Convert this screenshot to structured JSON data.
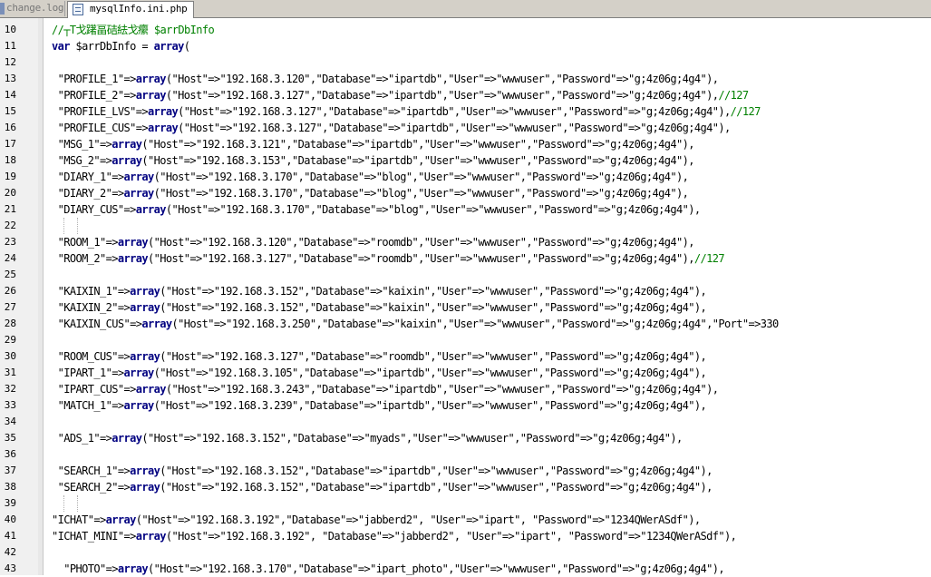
{
  "tabs": [
    {
      "label": "change.log",
      "active": false
    },
    {
      "label": "mysqlInfo.ini.php",
      "active": true
    }
  ],
  "lines": [
    {
      "n": "10",
      "text": "//┬T戈躇畐硈紶戈癳 $arrDbInfo",
      "kind": "comment"
    },
    {
      "n": "11",
      "text": "var $arrDbInfo = array(",
      "kind": "decl"
    },
    {
      "n": "12",
      "text": "",
      "kind": "blank"
    },
    {
      "n": "13",
      "text": " \"PROFILE_1\"=>array(\"Host\"=>\"192.168.3.120\",\"Database\"=>\"ipartdb\",\"User\"=>\"wwwuser\",\"Password\"=>\"g;4z06g;4g4\"),",
      "kind": "entry"
    },
    {
      "n": "14",
      "text": " \"PROFILE_2\"=>array(\"Host\"=>\"192.168.3.127\",\"Database\"=>\"ipartdb\",\"User\"=>\"wwwuser\",\"Password\"=>\"g;4z06g;4g4\"),//127",
      "kind": "entry"
    },
    {
      "n": "15",
      "text": " \"PROFILE_LVS\"=>array(\"Host\"=>\"192.168.3.127\",\"Database\"=>\"ipartdb\",\"User\"=>\"wwwuser\",\"Password\"=>\"g;4z06g;4g4\"),//127",
      "kind": "entry"
    },
    {
      "n": "16",
      "text": " \"PROFILE_CUS\"=>array(\"Host\"=>\"192.168.3.127\",\"Database\"=>\"ipartdb\",\"User\"=>\"wwwuser\",\"Password\"=>\"g;4z06g;4g4\"),",
      "kind": "entry"
    },
    {
      "n": "17",
      "text": " \"MSG_1\"=>array(\"Host\"=>\"192.168.3.121\",\"Database\"=>\"ipartdb\",\"User\"=>\"wwwuser\",\"Password\"=>\"g;4z06g;4g4\"),",
      "kind": "entry"
    },
    {
      "n": "18",
      "text": " \"MSG_2\"=>array(\"Host\"=>\"192.168.3.153\",\"Database\"=>\"ipartdb\",\"User\"=>\"wwwuser\",\"Password\"=>\"g;4z06g;4g4\"),",
      "kind": "entry"
    },
    {
      "n": "19",
      "text": " \"DIARY_1\"=>array(\"Host\"=>\"192.168.3.170\",\"Database\"=>\"blog\",\"User\"=>\"wwwuser\",\"Password\"=>\"g;4z06g;4g4\"),",
      "kind": "entry"
    },
    {
      "n": "20",
      "text": " \"DIARY_2\"=>array(\"Host\"=>\"192.168.3.170\",\"Database\"=>\"blog\",\"User\"=>\"wwwuser\",\"Password\"=>\"g;4z06g;4g4\"),",
      "kind": "entry"
    },
    {
      "n": "21",
      "text": " \"DIARY_CUS\"=>array(\"Host\"=>\"192.168.3.170\",\"Database\"=>\"blog\",\"User\"=>\"wwwuser\",\"Password\"=>\"g;4z06g;4g4\"),",
      "kind": "entry"
    },
    {
      "n": "22",
      "text": "",
      "kind": "blank-guide"
    },
    {
      "n": "23",
      "text": " \"ROOM_1\"=>array(\"Host\"=>\"192.168.3.120\",\"Database\"=>\"roomdb\",\"User\"=>\"wwwuser\",\"Password\"=>\"g;4z06g;4g4\"),",
      "kind": "entry"
    },
    {
      "n": "24",
      "text": " \"ROOM_2\"=>array(\"Host\"=>\"192.168.3.127\",\"Database\"=>\"roomdb\",\"User\"=>\"wwwuser\",\"Password\"=>\"g;4z06g;4g4\"),//127",
      "kind": "entry"
    },
    {
      "n": "25",
      "text": "",
      "kind": "blank"
    },
    {
      "n": "26",
      "text": " \"KAIXIN_1\"=>array(\"Host\"=>\"192.168.3.152\",\"Database\"=>\"kaixin\",\"User\"=>\"wwwuser\",\"Password\"=>\"g;4z06g;4g4\"),",
      "kind": "entry"
    },
    {
      "n": "27",
      "text": " \"KAIXIN_2\"=>array(\"Host\"=>\"192.168.3.152\",\"Database\"=>\"kaixin\",\"User\"=>\"wwwuser\",\"Password\"=>\"g;4z06g;4g4\"),",
      "kind": "entry"
    },
    {
      "n": "28",
      "text": " \"KAIXIN_CUS\"=>array(\"Host\"=>\"192.168.3.250\",\"Database\"=>\"kaixin\",\"User\"=>\"wwwuser\",\"Password\"=>\"g;4z06g;4g4\",\"Port\"=>330",
      "kind": "entry"
    },
    {
      "n": "29",
      "text": "",
      "kind": "blank"
    },
    {
      "n": "30",
      "text": " \"ROOM_CUS\"=>array(\"Host\"=>\"192.168.3.127\",\"Database\"=>\"roomdb\",\"User\"=>\"wwwuser\",\"Password\"=>\"g;4z06g;4g4\"),",
      "kind": "entry"
    },
    {
      "n": "31",
      "text": " \"IPART_1\"=>array(\"Host\"=>\"192.168.3.105\",\"Database\"=>\"ipartdb\",\"User\"=>\"wwwuser\",\"Password\"=>\"g;4z06g;4g4\"),",
      "kind": "entry"
    },
    {
      "n": "32",
      "text": " \"IPART_CUS\"=>array(\"Host\"=>\"192.168.3.243\",\"Database\"=>\"ipartdb\",\"User\"=>\"wwwuser\",\"Password\"=>\"g;4z06g;4g4\"),",
      "kind": "entry"
    },
    {
      "n": "33",
      "text": " \"MATCH_1\"=>array(\"Host\"=>\"192.168.3.239\",\"Database\"=>\"ipartdb\",\"User\"=>\"wwwuser\",\"Password\"=>\"g;4z06g;4g4\"),",
      "kind": "entry"
    },
    {
      "n": "34",
      "text": "",
      "kind": "blank"
    },
    {
      "n": "35",
      "text": " \"ADS_1\"=>array(\"Host\"=>\"192.168.3.152\",\"Database\"=>\"myads\",\"User\"=>\"wwwuser\",\"Password\"=>\"g;4z06g;4g4\"),",
      "kind": "entry"
    },
    {
      "n": "36",
      "text": "",
      "kind": "blank"
    },
    {
      "n": "37",
      "text": " \"SEARCH_1\"=>array(\"Host\"=>\"192.168.3.152\",\"Database\"=>\"ipartdb\",\"User\"=>\"wwwuser\",\"Password\"=>\"g;4z06g;4g4\"),",
      "kind": "entry"
    },
    {
      "n": "38",
      "text": " \"SEARCH_2\"=>array(\"Host\"=>\"192.168.3.152\",\"Database\"=>\"ipartdb\",\"User\"=>\"wwwuser\",\"Password\"=>\"g;4z06g;4g4\"),",
      "kind": "entry"
    },
    {
      "n": "39",
      "text": "",
      "kind": "blank-guide"
    },
    {
      "n": "40",
      "text": "\"ICHAT\"=>array(\"Host\"=>\"192.168.3.192\",\"Database\"=>\"jabberd2\", \"User\"=>\"ipart\", \"Password\"=>\"1234QWerASdf\"),",
      "kind": "entry"
    },
    {
      "n": "41",
      "text": "\"ICHAT_MINI\"=>array(\"Host\"=>\"192.168.3.192\", \"Database\"=>\"jabberd2\", \"User\"=>\"ipart\", \"Password\"=>\"1234QWerASdf\"),",
      "kind": "entry"
    },
    {
      "n": "42",
      "text": "",
      "kind": "blank"
    },
    {
      "n": "43",
      "text": "  \"PHOTO\"=>array(\"Host\"=>\"192.168.3.170\",\"Database\"=>\"ipart_photo\",\"User\"=>\"wwwuser\",\"Password\"=>\"g;4z06g;4g4\"),",
      "kind": "entry"
    }
  ]
}
